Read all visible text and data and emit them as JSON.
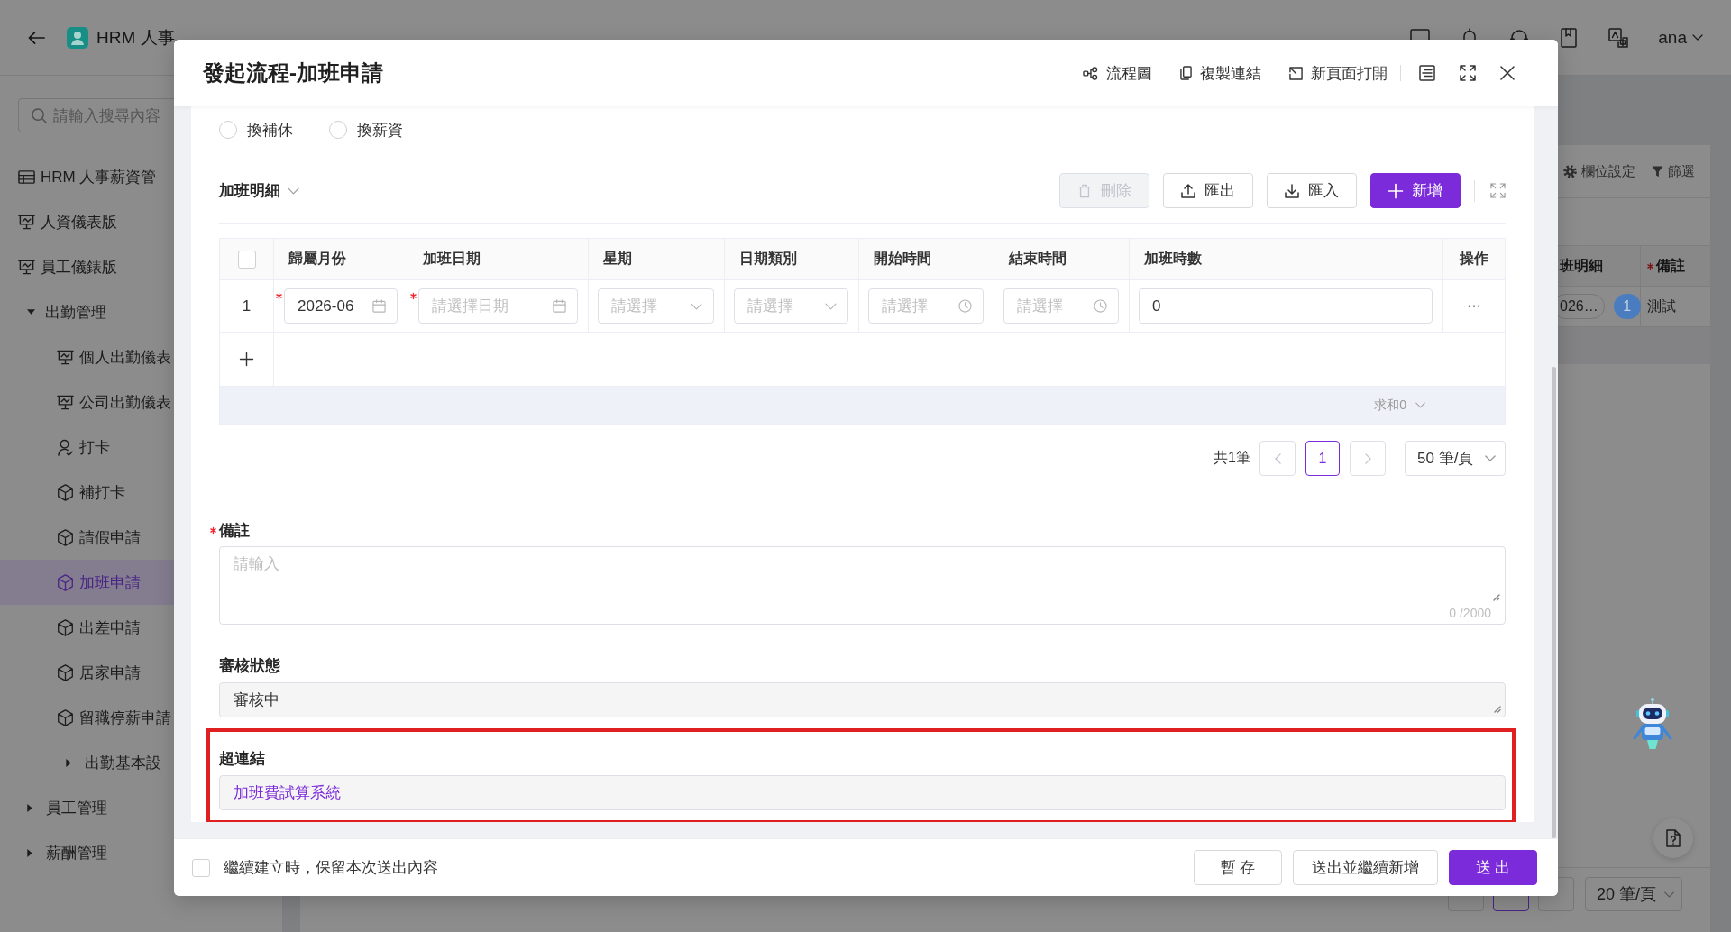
{
  "topbar": {
    "title": "HRM 人事",
    "user": "ana"
  },
  "sidebar": {
    "search": {
      "placeholder": "請輸入搜尋內容"
    },
    "items": [
      {
        "kind": "table",
        "label": "HRM 人事薪資管",
        "selected": false
      },
      {
        "kind": "dashboard",
        "label": "人資儀表版",
        "selected": false
      },
      {
        "kind": "dashboard",
        "label": "員工儀錶版",
        "selected": false
      },
      {
        "kind": "group",
        "label": "出勤管理",
        "selected": false,
        "expanded": true,
        "children": [
          {
            "kind": "dashboard",
            "label": "個人出勤儀表",
            "selected": false
          },
          {
            "kind": "dashboard",
            "label": "公司出勤儀表",
            "selected": false
          },
          {
            "kind": "user",
            "label": "打卡",
            "selected": false
          },
          {
            "kind": "form",
            "label": "補打卡",
            "selected": false
          },
          {
            "kind": "form",
            "label": "請假申請",
            "selected": false
          },
          {
            "kind": "form",
            "label": "加班申請",
            "selected": true
          },
          {
            "kind": "form",
            "label": "出差申請",
            "selected": false
          },
          {
            "kind": "form",
            "label": "居家申請",
            "selected": false
          },
          {
            "kind": "form",
            "label": "留職停薪申請",
            "selected": false
          },
          {
            "kind": "group",
            "label": "出勤基本設",
            "selected": false,
            "expanded": false
          }
        ]
      },
      {
        "kind": "group",
        "label": "員工管理",
        "selected": false,
        "expanded": false
      },
      {
        "kind": "group",
        "label": "薪酬管理",
        "selected": false,
        "expanded": false
      }
    ]
  },
  "list": {
    "toolbar": [
      {
        "kind": "settings",
        "label": "欄位設定"
      },
      {
        "kind": "filter",
        "label": "篩選"
      }
    ],
    "columns": [
      {
        "label": "班明細",
        "required": false
      },
      {
        "label": "備註",
        "required": true
      }
    ],
    "rows": [
      {
        "detail": "026…",
        "count": "1",
        "remark": "測試"
      }
    ],
    "pagination": {
      "pages": [
        {
          "selected": true
        }
      ],
      "page_size": "20 筆/頁"
    }
  },
  "dialog": {
    "title": "發起流程-加班申請",
    "actions": [
      {
        "kind": "flowchart",
        "label": "流程圖"
      },
      {
        "kind": "copy",
        "label": "複製連結"
      },
      {
        "kind": "open",
        "label": "新頁面打開"
      }
    ],
    "compensation": {
      "options": [
        {
          "label": "換補休",
          "selected": false
        },
        {
          "label": "換薪資",
          "selected": false
        }
      ]
    },
    "detail": {
      "title": "加班明細",
      "expanded": true,
      "buttons": [
        {
          "kind": "delete",
          "label": "刪除",
          "disabled": true
        },
        {
          "kind": "export",
          "label": "匯出",
          "disabled": false
        },
        {
          "kind": "import",
          "label": "匯入",
          "disabled": false
        },
        {
          "kind": "add",
          "label": "新增",
          "disabled": false
        }
      ],
      "table": {
        "select_all": {
          "checked": false
        },
        "columns": [
          {
            "label": "歸屬月份"
          },
          {
            "label": "加班日期"
          },
          {
            "label": "星期"
          },
          {
            "label": "日期類別"
          },
          {
            "label": "開始時間"
          },
          {
            "label": "結束時間"
          },
          {
            "label": "加班時數"
          },
          {
            "label": "操作"
          }
        ],
        "rows": [
          {
            "number": "1",
            "cells": [
              {
                "kind": "month",
                "value": "2026-06",
                "required": true
              },
              {
                "kind": "date",
                "placeholder": "請選擇日期",
                "required": true
              },
              {
                "kind": "select",
                "placeholder": "請選擇",
                "required": false
              },
              {
                "kind": "select",
                "placeholder": "請選擇",
                "required": false
              },
              {
                "kind": "time",
                "placeholder": "請選擇",
                "required": false
              },
              {
                "kind": "time",
                "placeholder": "請選擇",
                "required": false
              },
              {
                "kind": "number",
                "value": "0",
                "required": false
              },
              {
                "kind": "actions",
                "required": false
              }
            ]
          }
        ],
        "summary": "求和0"
      },
      "pagination": {
        "total": "共1筆",
        "pages": [
          {
            "label": "1",
            "selected": true
          }
        ],
        "page_size": "50 筆/頁"
      }
    },
    "remark": {
      "label": "備註",
      "required": true,
      "placeholder": "請輸入",
      "counter": "0 /2000"
    },
    "review_status": {
      "label": "審核狀態",
      "value": "審核中"
    },
    "hyperlink": {
      "label": "超連結",
      "link": "加班費試算系統",
      "highlighted": true
    },
    "footer": {
      "keep": {
        "label": "繼續建立時，保留本次送出內容",
        "checked": false
      },
      "buttons": [
        {
          "kind": "draft",
          "label": "暫 存"
        },
        {
          "kind": "submit_and_new",
          "label": "送出並繼續新增"
        },
        {
          "kind": "submit",
          "label": "送 出"
        }
      ]
    }
  }
}
